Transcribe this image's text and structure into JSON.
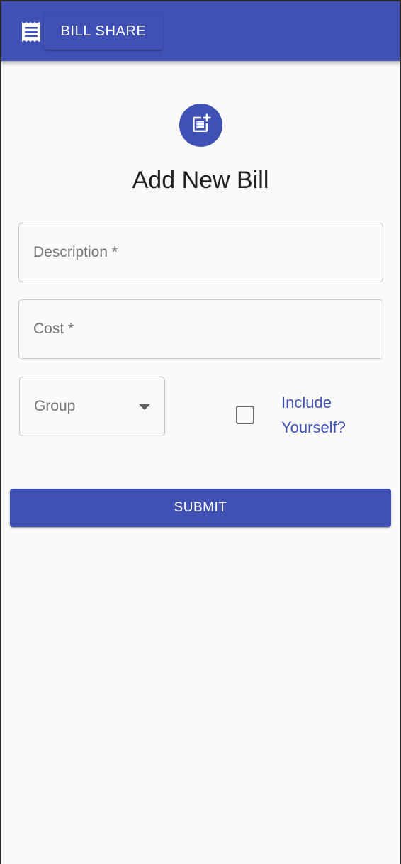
{
  "appbar": {
    "menu_icon": "receipt-icon",
    "title": "BILL SHARE"
  },
  "form": {
    "header_icon": "post-add-icon",
    "title": "Add New Bill",
    "description": {
      "placeholder": "Description *",
      "value": ""
    },
    "cost": {
      "placeholder": "Cost *",
      "value": ""
    },
    "group": {
      "label": "Group",
      "selected": ""
    },
    "include_yourself": {
      "label": "Include Yourself?",
      "checked": false
    },
    "submit_label": "SUBMIT"
  },
  "colors": {
    "primary": "#3f51b5",
    "background": "#fafafa",
    "text": "#212121",
    "placeholder": "#757575",
    "field_border": "#c4c4c4"
  }
}
